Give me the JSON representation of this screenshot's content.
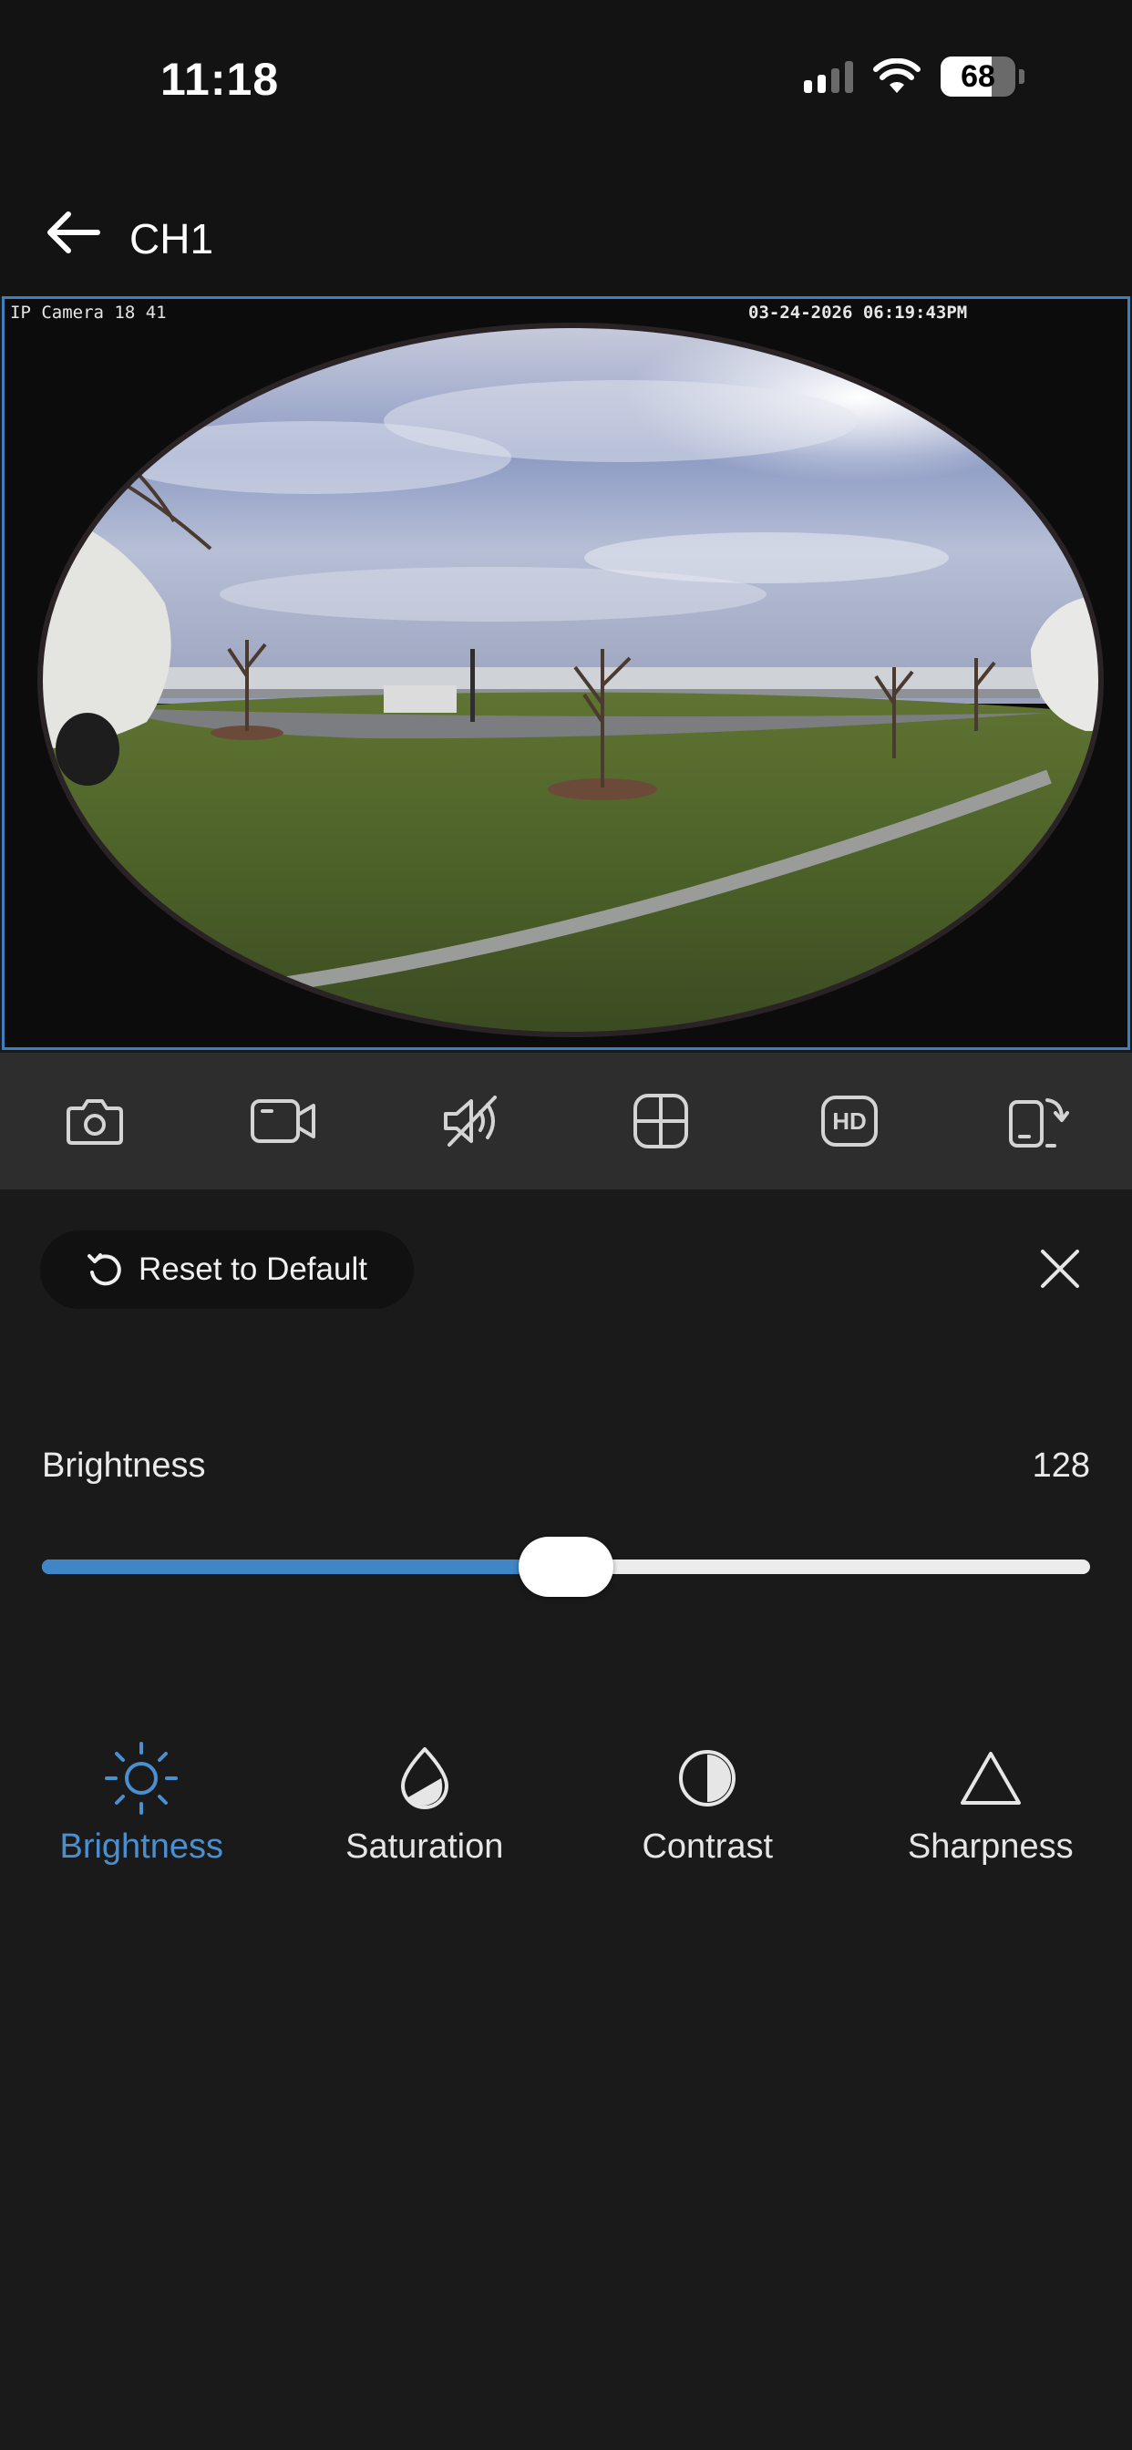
{
  "status_bar": {
    "time": "11:18",
    "battery": "68",
    "battery_level": 0.68,
    "signal_bars_active": 2,
    "icons": [
      "cellular-signal-icon",
      "wifi-icon",
      "battery-icon"
    ]
  },
  "header": {
    "back_icon": "arrow-left-icon",
    "title": "CH1"
  },
  "video": {
    "osd_label": "IP Camera 18 41",
    "osd_timestamp": "03-24-2026 06:19:43PM",
    "border_color": "#3e7fbf"
  },
  "toolbar": {
    "tools": [
      {
        "name": "snapshot",
        "icon": "camera-icon"
      },
      {
        "name": "record",
        "icon": "video-camera-icon"
      },
      {
        "name": "mute",
        "icon": "speaker-muted-icon"
      },
      {
        "name": "split-view",
        "icon": "grid-icon"
      },
      {
        "name": "quality",
        "icon": "hd-icon",
        "label": "HD"
      },
      {
        "name": "rotate",
        "icon": "rotate-screen-icon"
      }
    ]
  },
  "image_adjust": {
    "reset_label": "Reset to Default",
    "reset_icon": "reset-icon",
    "close_icon": "close-icon",
    "slider": {
      "label": "Brightness",
      "value": "128",
      "fraction": 0.5,
      "accent": "#3f86c6"
    },
    "tabs": [
      {
        "label": "Brightness",
        "icon": "sun-icon",
        "active": true
      },
      {
        "label": "Saturation",
        "icon": "droplet-icon",
        "active": false
      },
      {
        "label": "Contrast",
        "icon": "contrast-icon",
        "active": false
      },
      {
        "label": "Sharpness",
        "icon": "triangle-icon",
        "active": false
      }
    ],
    "active_color": "#4a8fd0"
  }
}
